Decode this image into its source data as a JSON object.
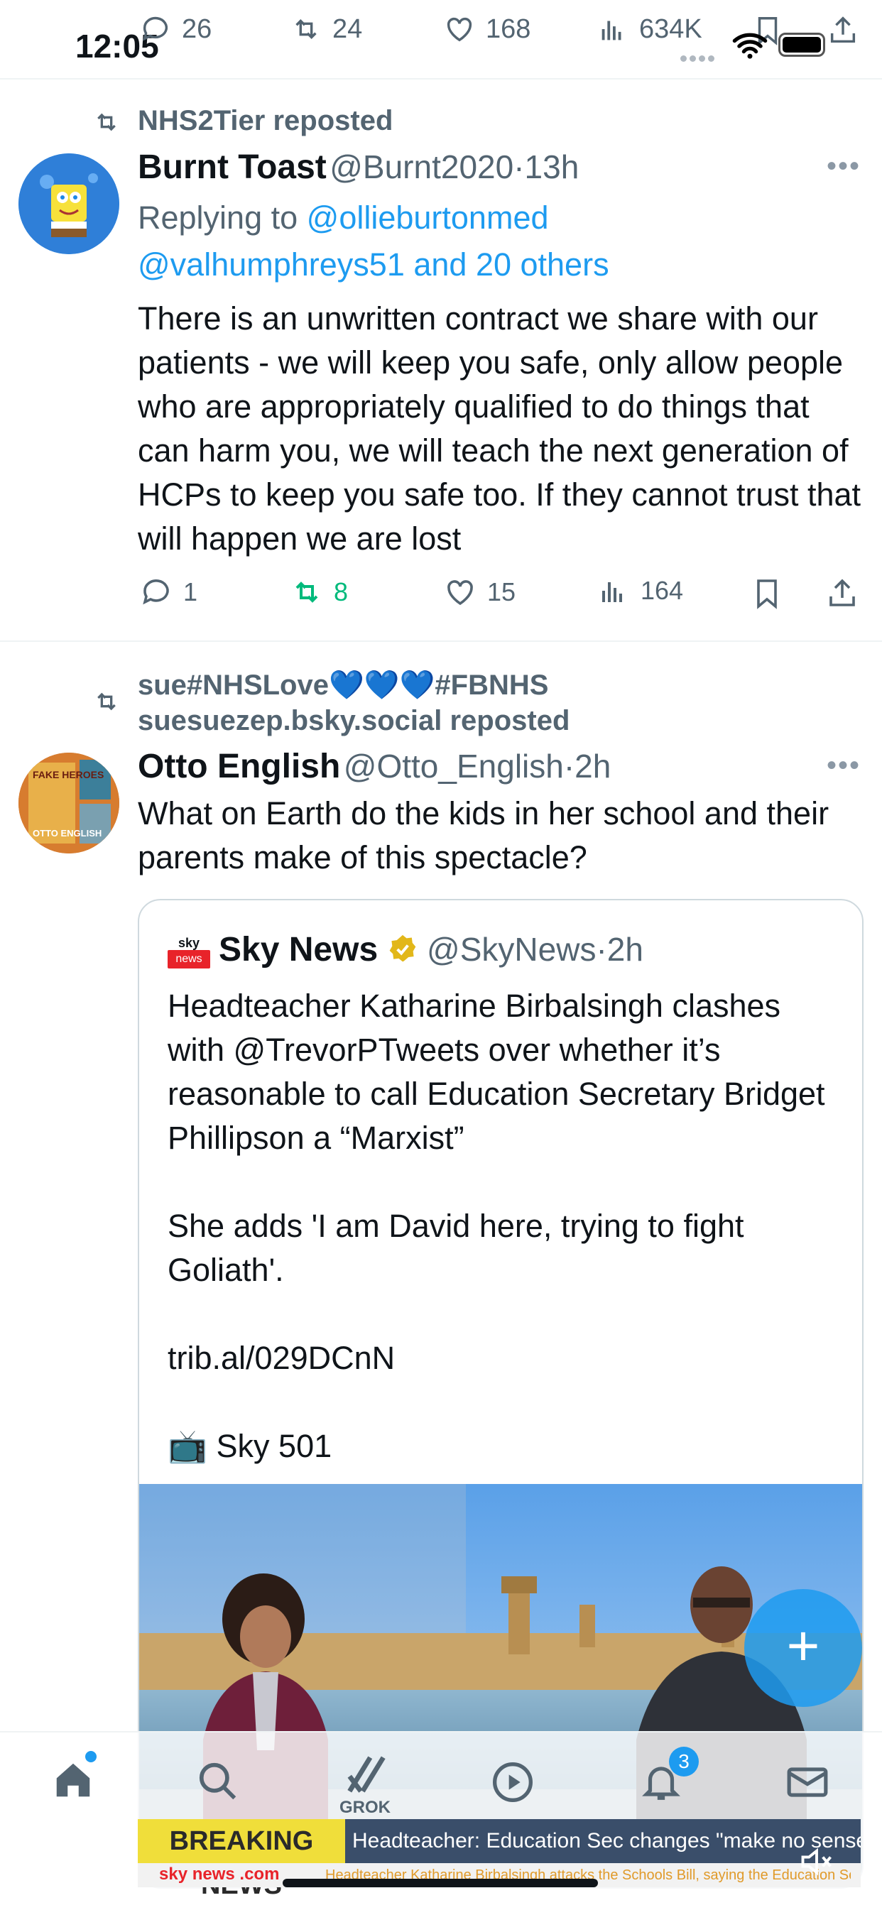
{
  "status_bar": {
    "time": "12:05"
  },
  "top_actions": {
    "replies": "26",
    "reposts": "24",
    "likes": "168",
    "views": "634K"
  },
  "colors": {
    "accent": "#1d9bf0",
    "repost_green": "#00ba7c",
    "muted": "#536471",
    "verified_gold": "#e2b719"
  },
  "post1": {
    "repost_label": "NHS2Tier reposted",
    "author_name": "Burnt Toast",
    "handle": "@Burnt2020",
    "separator": "·",
    "time": "13h",
    "replying_prefix": "Replying to ",
    "reply_to_1": "@ollieburtonmed",
    "reply_to_2": "@valhumphreys51 and 20 others",
    "text": "There is an unwritten contract we share with our patients - we will keep you safe, only allow people who are appropriately qualified to do things that can harm you, we will teach the next generation of HCPs to keep you safe too. If they cannot trust that will happen we are lost",
    "replies": "1",
    "reposts": "8",
    "likes": "15",
    "views": "164"
  },
  "post2": {
    "repost_line1": "sue#NHSLove💙💙💙#FBNHS",
    "repost_line2": "suesuezep.bsky.social reposted",
    "author_name": "Otto English",
    "handle": "@Otto_English",
    "separator": "·",
    "time": "2h",
    "text": "What on Earth do the kids in her school and their parents make of this spectacle?",
    "avatar_text_top": "FAKE HEROES",
    "avatar_text_bottom": "OTTO ENGLISH"
  },
  "quote": {
    "logo_top": "sky",
    "logo_bottom": "news",
    "author_name": "Sky News",
    "handle": "@SkyNews",
    "separator": "·",
    "time": "2h",
    "para1": "Headteacher Katharine Birbalsingh clashes with @TrevorPTweets  over whether it’s reasonable to call Education Secretary Bridget Phillipson a “Marxist”",
    "para2": "She adds 'I am David here, trying to fight Goliath'.",
    "para3": "trib.al/029DCnN",
    "para4_icon": "📺",
    "para4_text": " Sky 501"
  },
  "media": {
    "breaking_label": "BREAKING NEWS",
    "headline": "Headteacher: Education Sec changes \"make no sense\"",
    "brand": "sky news .com",
    "ticker": "Headteacher Katharine Birbalsingh attacks the Schools Bill, saying the Education Se"
  },
  "bottom_nav": {
    "grok_label": "GROK",
    "notifications_badge": "3",
    "items": [
      "home-icon",
      "search-icon",
      "grok-icon",
      "video-icon",
      "bell-icon",
      "mail-icon"
    ]
  }
}
